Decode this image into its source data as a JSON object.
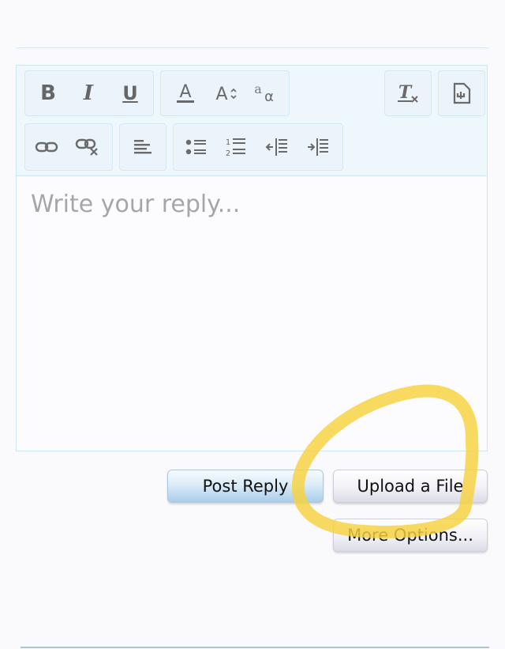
{
  "toolbar": {
    "row1": [
      {
        "name": "bold-button",
        "icon": "bold-icon",
        "glyph": "B"
      },
      {
        "name": "italic-button",
        "icon": "italic-icon",
        "glyph": "I"
      },
      {
        "name": "underline-button",
        "icon": "underline-icon",
        "glyph": "U"
      },
      {
        "name": "font-color-button",
        "icon": "font-color-icon",
        "glyph": "A"
      },
      {
        "name": "font-size-button",
        "icon": "font-size-icon",
        "glyph": "A"
      },
      {
        "name": "font-family-button",
        "icon": "font-family-icon",
        "glyph": "aa"
      },
      {
        "name": "remove-formatting-button",
        "icon": "remove-formatting-icon",
        "glyph": "T"
      },
      {
        "name": "toggle-bbcode-button",
        "icon": "toggle-source-icon",
        "glyph": ""
      }
    ],
    "row2": [
      {
        "name": "link-button",
        "icon": "link-icon"
      },
      {
        "name": "unlink-button",
        "icon": "unlink-icon"
      },
      {
        "name": "align-button",
        "icon": "align-left-icon"
      },
      {
        "name": "bullet-list-button",
        "icon": "bullet-list-icon"
      },
      {
        "name": "numbered-list-button",
        "icon": "numbered-list-icon"
      },
      {
        "name": "outdent-button",
        "icon": "outdent-icon"
      },
      {
        "name": "indent-button",
        "icon": "indent-icon"
      }
    ]
  },
  "editor": {
    "placeholder": "Write your reply..."
  },
  "actions": {
    "post_reply": "Post Reply",
    "upload_file": "Upload a File",
    "more_options": "More Options..."
  },
  "annotation": {
    "color": "#f7d23e",
    "shape": "hand-drawn-circle"
  }
}
